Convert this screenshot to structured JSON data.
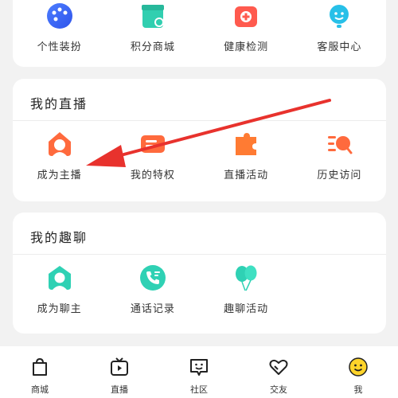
{
  "top_section": {
    "items": [
      {
        "label": "个性装扮",
        "icon": "palette-icon"
      },
      {
        "label": "积分商城",
        "icon": "shop-icon"
      },
      {
        "label": "健康检测",
        "icon": "medical-kit-icon"
      },
      {
        "label": "客服中心",
        "icon": "customer-service-icon"
      }
    ]
  },
  "live_section": {
    "title": "我的直播",
    "items": [
      {
        "label": "成为主播",
        "icon": "host-icon"
      },
      {
        "label": "我的特权",
        "icon": "privilege-icon"
      },
      {
        "label": "直播活动",
        "icon": "puzzle-icon"
      },
      {
        "label": "历史访问",
        "icon": "history-icon"
      }
    ]
  },
  "chat_section": {
    "title": "我的趣聊",
    "items": [
      {
        "label": "成为聊主",
        "icon": "chat-host-icon"
      },
      {
        "label": "通话记录",
        "icon": "call-log-icon"
      },
      {
        "label": "趣聊活动",
        "icon": "balloon-icon"
      }
    ]
  },
  "bottom_nav": {
    "items": [
      {
        "label": "商城",
        "icon": "shopping-bag-icon"
      },
      {
        "label": "直播",
        "icon": "tv-icon"
      },
      {
        "label": "社区",
        "icon": "community-icon"
      },
      {
        "label": "交友",
        "icon": "heart-icon"
      },
      {
        "label": "我",
        "icon": "smiley-avatar-icon"
      }
    ]
  },
  "colors": {
    "accent": "#ff5a3c",
    "teal": "#2fd1b4",
    "arrow": "#e8322d"
  }
}
